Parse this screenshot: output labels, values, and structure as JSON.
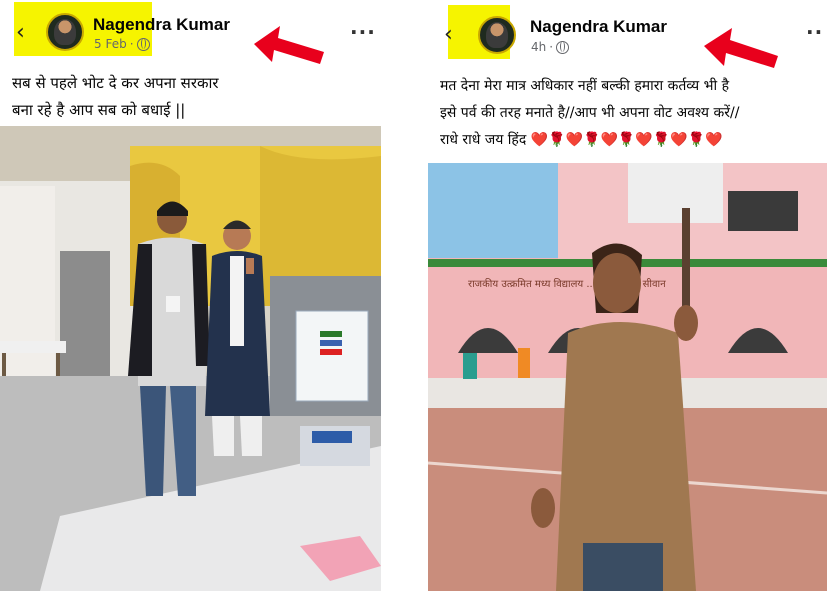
{
  "posts": [
    {
      "author": "Nagendra Kumar",
      "timestamp": "5 Feb",
      "privacy_icon": "globe-icon",
      "caption_lines": [
        "सब से पहले भोट दे कर अपना सरकार",
        "बना रहे है आप सब को बधाई ||"
      ],
      "highlight_color": "#f6f400",
      "arrow_color": "#e8001c"
    },
    {
      "author": "Nagendra Kumar",
      "timestamp": "4h",
      "privacy_icon": "globe-icon",
      "caption_lines": [
        "मत देना मेरा मात्र अधिकार नहीं बल्की हमारा कर्तव्य भी है",
        "इसे पर्व की तरह मनाते है//आप भी अपना वोट अवश्य करें//",
        "राधे राधे जय हिंद ❤️🌹❤️🌹❤️🌹❤️🌹❤️🌹❤️"
      ],
      "photo_sign_text": "राजकीय उत्क्रमित मध्य विद्यालय ... प्रखंड मुंदरी सीवान",
      "highlight_color": "#f6f400",
      "arrow_color": "#e8001c"
    }
  ]
}
